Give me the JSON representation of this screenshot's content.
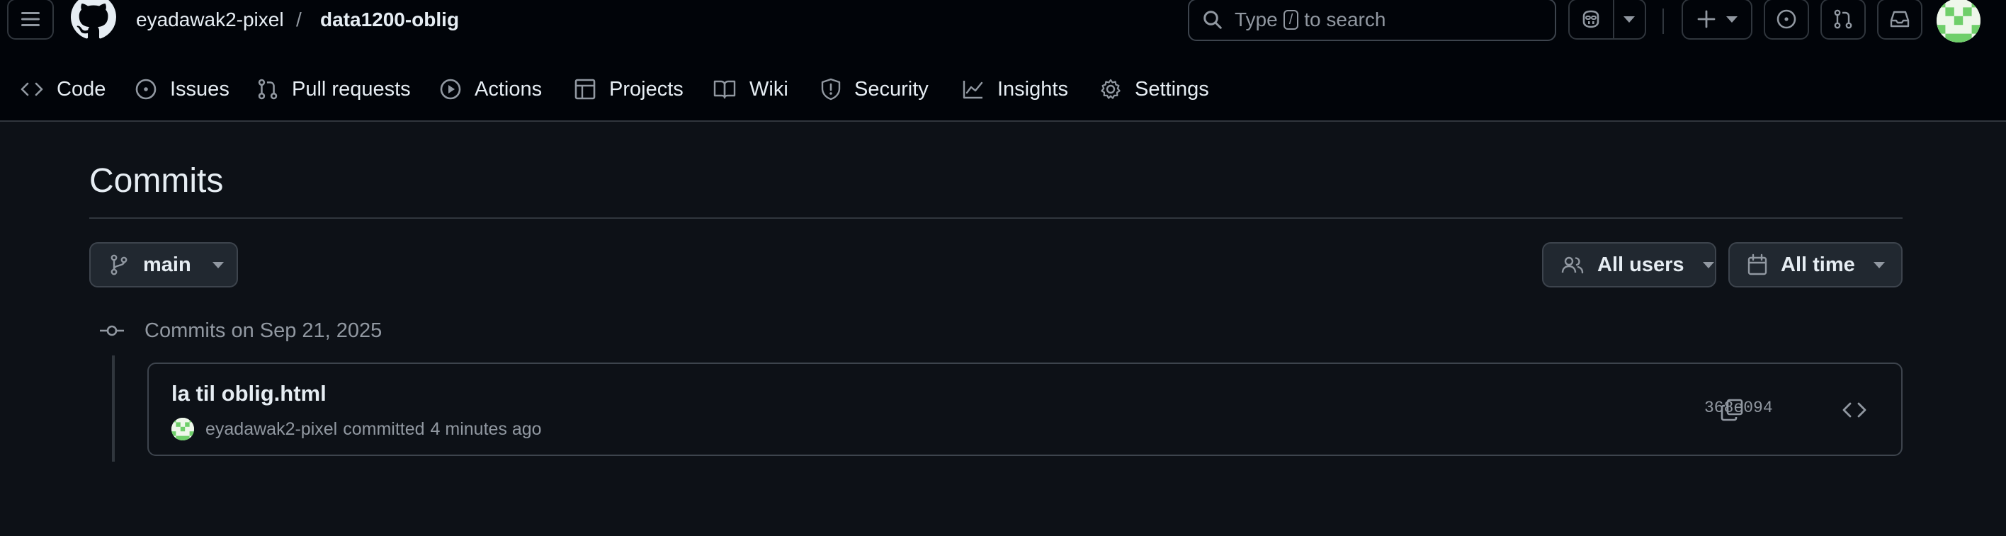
{
  "header": {
    "owner": "eyadawak2-pixel",
    "separator": "/",
    "repo": "data1200-oblig",
    "search": {
      "prefix": "Type",
      "key": "/",
      "suffix": "to search"
    }
  },
  "tabs": [
    {
      "label": "Code",
      "icon": "code-icon"
    },
    {
      "label": "Issues",
      "icon": "issue-opened-icon"
    },
    {
      "label": "Pull requests",
      "icon": "git-pull-request-icon"
    },
    {
      "label": "Actions",
      "icon": "play-icon"
    },
    {
      "label": "Projects",
      "icon": "table-icon"
    },
    {
      "label": "Wiki",
      "icon": "book-icon"
    },
    {
      "label": "Security",
      "icon": "shield-icon"
    },
    {
      "label": "Insights",
      "icon": "graph-icon"
    },
    {
      "label": "Settings",
      "icon": "gear-icon"
    }
  ],
  "page": {
    "title": "Commits"
  },
  "filters": {
    "branch": "main",
    "users": "All users",
    "time": "All time"
  },
  "commit_groups": [
    {
      "heading": "Commits on Sep 21, 2025",
      "commits": [
        {
          "message": "la til oblig.html",
          "author": "eyadawak2-pixel",
          "action": "committed",
          "time": "4 minutes ago",
          "sha": "368e094"
        }
      ]
    }
  ],
  "colors": {
    "page_bg": "#0d1117",
    "header_bg": "#010409",
    "border": "#30363d",
    "text": "#e6edf3",
    "muted": "#9198a1",
    "avatar_green": "#6fcf6a"
  }
}
